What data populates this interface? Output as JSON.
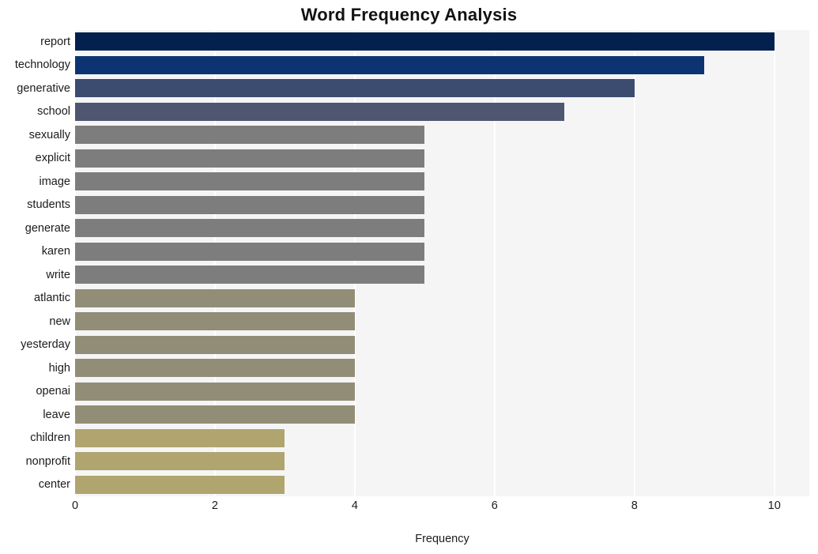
{
  "chart_data": {
    "type": "bar",
    "orientation": "horizontal",
    "title": "Word Frequency Analysis",
    "xlabel": "Frequency",
    "ylabel": "",
    "xlim": [
      0,
      10.5
    ],
    "xticks": [
      0,
      2,
      4,
      6,
      8,
      10
    ],
    "xtick_labels": [
      "0",
      "2",
      "4",
      "6",
      "8",
      "10"
    ],
    "grid": true,
    "grid_axis": "x",
    "grid_color": "#ffffff",
    "plot_background": "#f5f5f6",
    "figure_background": "#ffffff",
    "legend": null,
    "categories": [
      "report",
      "technology",
      "generative",
      "school",
      "sexually",
      "explicit",
      "image",
      "students",
      "generate",
      "karen",
      "write",
      "atlantic",
      "new",
      "yesterday",
      "high",
      "openai",
      "leave",
      "children",
      "nonprofit",
      "center"
    ],
    "values": [
      10,
      9,
      8,
      7,
      5,
      5,
      5,
      5,
      5,
      5,
      5,
      4,
      4,
      4,
      4,
      4,
      4,
      3,
      3,
      3
    ],
    "bar_colors": [
      "#03204f",
      "#0d3472",
      "#3c4b70",
      "#4e5670",
      "#7d7d7d",
      "#7d7d7d",
      "#7d7d7d",
      "#7d7d7d",
      "#7d7d7d",
      "#7d7d7d",
      "#7d7d7d",
      "#928d76",
      "#928d76",
      "#928d76",
      "#928d76",
      "#928d76",
      "#928d76",
      "#b0a46f",
      "#b0a46f",
      "#b0a46f"
    ]
  }
}
